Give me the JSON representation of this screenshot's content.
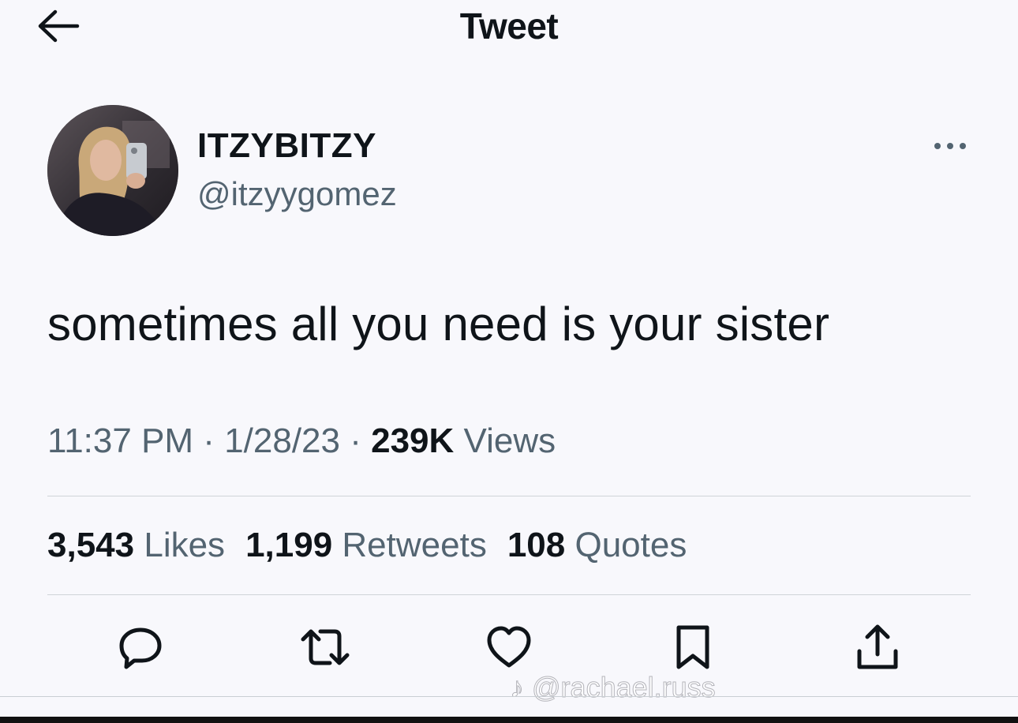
{
  "header": {
    "title": "Tweet",
    "back_icon": "arrow-left-icon"
  },
  "author": {
    "display_name": "ITZYBITZY",
    "handle": "@itzyygomez",
    "avatar_icon": "avatar-photo"
  },
  "tweet": {
    "text": "sometimes all you need is your sister",
    "time": "11:37 PM",
    "separator": " · ",
    "date": "1/28/23",
    "views_count": "239K",
    "views_label": "Views"
  },
  "stats": {
    "likes_count": "3,543",
    "likes_label": "Likes",
    "retweets_count": "1,199",
    "retweets_label": "Retweets",
    "quotes_count": "108",
    "quotes_label": "Quotes"
  },
  "actions": [
    {
      "name": "reply",
      "icon": "reply-icon"
    },
    {
      "name": "retweet",
      "icon": "retweet-icon"
    },
    {
      "name": "like",
      "icon": "heart-icon"
    },
    {
      "name": "bookmark",
      "icon": "bookmark-icon"
    },
    {
      "name": "share",
      "icon": "share-icon"
    }
  ],
  "watermark": {
    "text": "@rachael.russ"
  },
  "colors": {
    "text_primary": "#0f1419",
    "text_secondary": "#536471",
    "background": "#f8f8fc",
    "divider": "#cfd4d8"
  }
}
